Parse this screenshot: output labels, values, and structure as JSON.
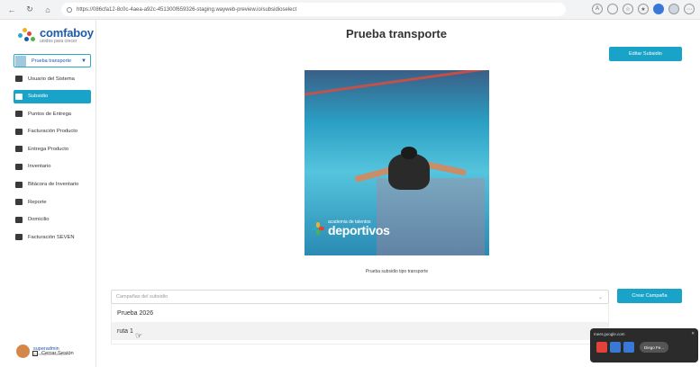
{
  "browser": {
    "url": "https://086cfa12-8c0c-4aea-a92c-451300f659326-staging.wayweb-preview.io/subsidioselect"
  },
  "sidebar": {
    "brand": {
      "name": "comfaboy",
      "tagline": "unidos para crecer"
    },
    "selector": {
      "label": "Prueba transporte"
    },
    "items": [
      {
        "label": "Usuario del Sistema",
        "icon": "user-icon",
        "active": false
      },
      {
        "label": "Subsidio",
        "icon": "user-icon",
        "active": true
      },
      {
        "label": "Puntos de Entrega",
        "icon": "pin-icon",
        "active": false
      },
      {
        "label": "Facturación Producto",
        "icon": "invoice-icon",
        "active": false
      },
      {
        "label": "Entrega Producto",
        "icon": "package-icon",
        "active": false
      },
      {
        "label": "Inventario",
        "icon": "inventory-icon",
        "active": false
      },
      {
        "label": "Bitácora de Inventario",
        "icon": "log-icon",
        "active": false
      },
      {
        "label": "Reporte",
        "icon": "report-icon",
        "active": false
      },
      {
        "label": "Domicilio",
        "icon": "truck-icon",
        "active": false
      },
      {
        "label": "Facturación SEVEN",
        "icon": "invoice-icon",
        "active": false
      }
    ],
    "user": {
      "name": "superadmin",
      "email": "admin@comfaboy.com"
    },
    "logout_label": "Cerrar Sesión"
  },
  "main": {
    "title": "Prueba transporte",
    "edit_button": "Editar Subsidio",
    "hero": {
      "small": "academia de talentos",
      "big": "deportivos"
    },
    "caption": "Prueba subsidio tipo transporte",
    "campaign_select": {
      "placeholder": "Campañas del subsidio",
      "options": [
        "Prueba 2026",
        "ruta 1"
      ]
    },
    "create_button": "Crear Campaña"
  },
  "meet_overlay": {
    "site": "meet.google.com",
    "participant": "Diego Fe..."
  },
  "colors": {
    "accent": "#1aa3c8",
    "brand": "#1d5aa8"
  }
}
